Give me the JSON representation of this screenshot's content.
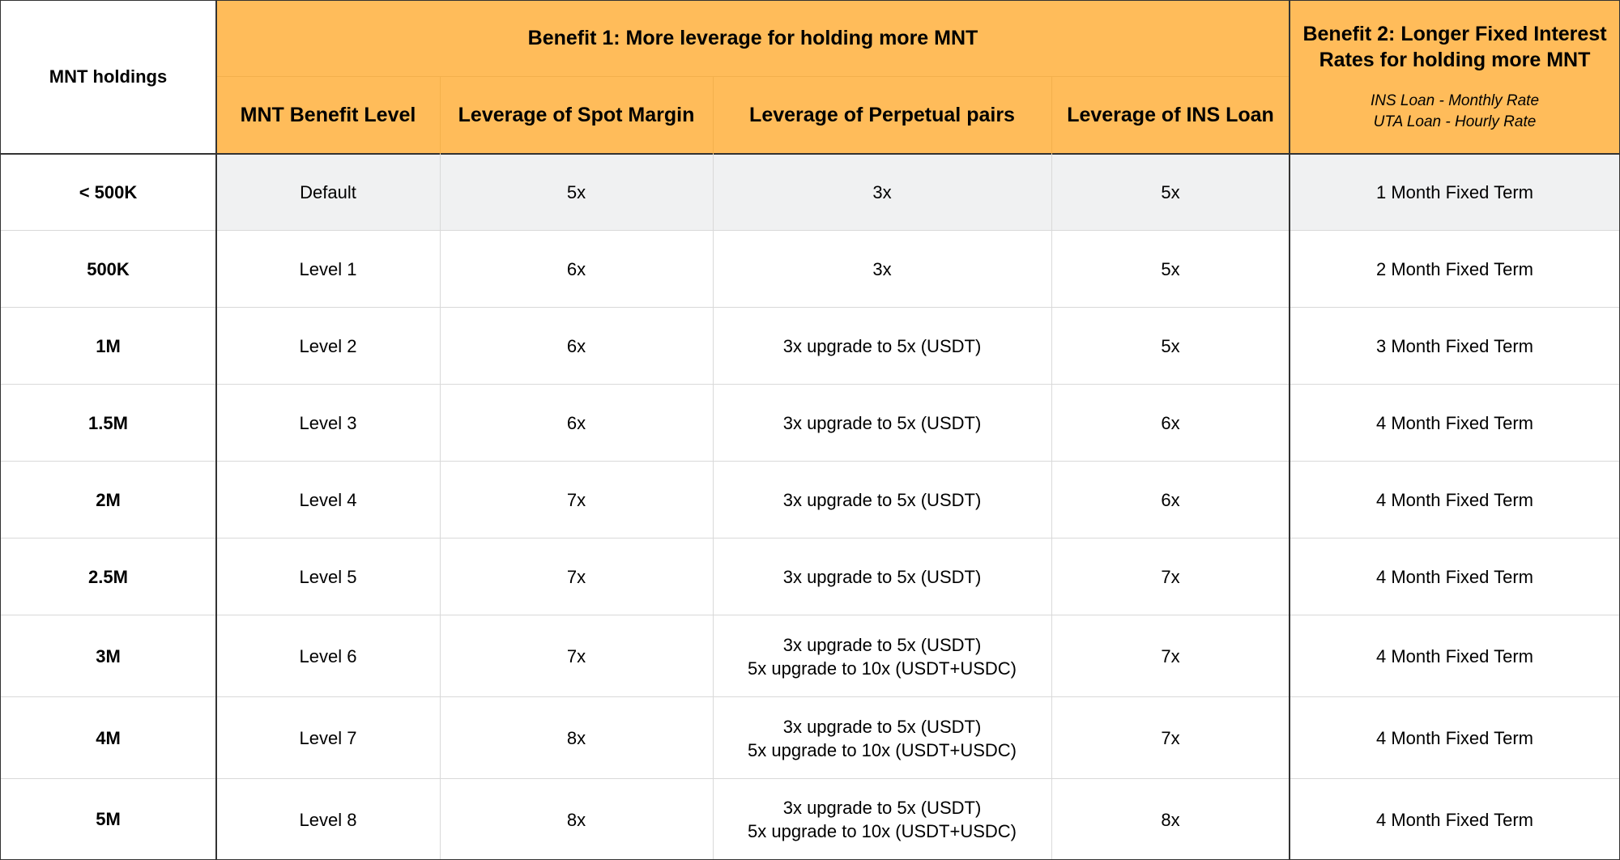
{
  "header": {
    "holdings_label": "MNT holdings",
    "benefit1_title": "Benefit 1: More leverage for holding more MNT",
    "benefit2_title_line1": "Benefit 2: Longer Fixed Interest",
    "benefit2_title_line2": "Rates for holding more MNT",
    "benefit2_note_line1": "INS Loan - Monthly Rate",
    "benefit2_note_line2": "UTA Loan - Hourly Rate",
    "columns": [
      "MNT Benefit Level",
      "Leverage of Spot Margin",
      "Leverage of Perpetual pairs",
      "Leverage of INS Loan"
    ]
  },
  "rows": [
    {
      "holdings": "< 500K",
      "level": "Default",
      "spot": "5x",
      "perp": [
        "3x"
      ],
      "ins": "5x",
      "term": "1 Month Fixed Term"
    },
    {
      "holdings": "500K",
      "level": "Level 1",
      "spot": "6x",
      "perp": [
        "3x"
      ],
      "ins": "5x",
      "term": "2 Month Fixed Term"
    },
    {
      "holdings": "1M",
      "level": "Level 2",
      "spot": "6x",
      "perp": [
        "3x upgrade to 5x (USDT)"
      ],
      "ins": "5x",
      "term": "3 Month Fixed Term"
    },
    {
      "holdings": "1.5M",
      "level": "Level 3",
      "spot": "6x",
      "perp": [
        "3x upgrade to 5x (USDT)"
      ],
      "ins": "6x",
      "term": "4 Month Fixed Term"
    },
    {
      "holdings": "2M",
      "level": "Level 4",
      "spot": "7x",
      "perp": [
        "3x upgrade to 5x (USDT)"
      ],
      "ins": "6x",
      "term": "4 Month Fixed Term"
    },
    {
      "holdings": "2.5M",
      "level": "Level 5",
      "spot": "7x",
      "perp": [
        "3x upgrade to 5x (USDT)"
      ],
      "ins": "7x",
      "term": "4 Month Fixed Term"
    },
    {
      "holdings": "3M",
      "level": "Level 6",
      "spot": "7x",
      "perp": [
        "3x upgrade to 5x (USDT)",
        "5x upgrade to 10x (USDT+USDC)"
      ],
      "ins": "7x",
      "term": "4 Month Fixed Term"
    },
    {
      "holdings": "4M",
      "level": "Level 7",
      "spot": "8x",
      "perp": [
        "3x upgrade to 5x (USDT)",
        "5x upgrade to 10x (USDT+USDC)"
      ],
      "ins": "7x",
      "term": "4 Month Fixed Term"
    },
    {
      "holdings": "5M",
      "level": "Level 8",
      "spot": "8x",
      "perp": [
        "3x upgrade to 5x (USDT)",
        "5x upgrade to 10x (USDT+USDC)"
      ],
      "ins": "8x",
      "term": "4 Month Fixed Term"
    }
  ],
  "colors": {
    "header_bg": "#ffbc5a",
    "default_row_bg": "#f0f1f2",
    "grid": "#d9d9d9"
  }
}
